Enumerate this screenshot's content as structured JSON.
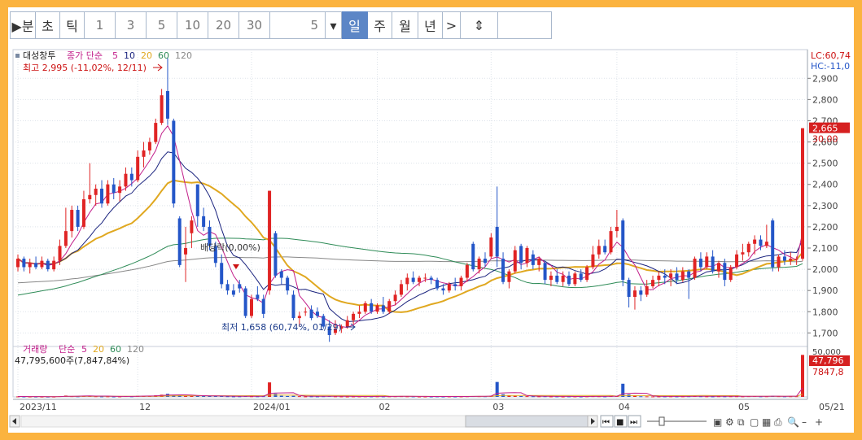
{
  "toolbar": {
    "items": [
      {
        "label": "▶분",
        "kind": "text"
      },
      {
        "label": "초",
        "kind": "text"
      },
      {
        "label": "틱",
        "kind": "text"
      },
      {
        "label": "1",
        "kind": "num"
      },
      {
        "label": "3",
        "kind": "num"
      },
      {
        "label": "5",
        "kind": "num"
      },
      {
        "label": "10",
        "kind": "num"
      },
      {
        "label": "20",
        "kind": "num"
      },
      {
        "label": "30",
        "kind": "num"
      },
      {
        "label": "5",
        "kind": "num"
      },
      {
        "label": "▾",
        "kind": "text"
      },
      {
        "label": "일",
        "kind": "active"
      },
      {
        "label": "주",
        "kind": "text"
      },
      {
        "label": "월",
        "kind": "text"
      },
      {
        "label": "년",
        "kind": "text"
      },
      {
        "label": ">",
        "kind": "text"
      },
      {
        "label": "⇕",
        "kind": "text"
      },
      {
        "label": "",
        "kind": "text"
      }
    ]
  },
  "legend": {
    "stock_name": "대성창투",
    "ma_label": "종가 단순",
    "ma_periods": [
      "5",
      "10",
      "20",
      "60",
      "120"
    ],
    "volume_name": "거래량",
    "volume_ma_label": "단순",
    "volume_ma_periods": [
      "5",
      "20",
      "60",
      "120"
    ],
    "volume_info": "47,795,600주(7,847,84%)"
  },
  "colors": {
    "up": "#e02424",
    "down": "#2456c8",
    "ma5": "#c21f8a",
    "ma10": "#1a237e",
    "ma20": "#e0a820",
    "ma60": "#2e8b57",
    "ma120": "#888888"
  },
  "annotations": {
    "high": "최고 2,995 (-11,02%, 12/11)",
    "low": "최저 1,658 (60,74%, 01/29)",
    "ex_dividend": "배당락(0,00%)"
  },
  "right_labels": {
    "lc": "LC:60,74",
    "hc": "HC:-11,0",
    "last_price": "2,665",
    "pct": "30,00",
    "last_volume": "47,796",
    "vol_sub": "7847,8",
    "vol_top": "50,000"
  },
  "chart_data": [
    {
      "type": "candlestick",
      "title": "",
      "y_ticks": [
        1700,
        1800,
        1900,
        2000,
        2100,
        2200,
        2300,
        2400,
        2500,
        2600,
        2700,
        2800,
        2900
      ],
      "ylim": [
        1640,
        3020
      ],
      "x_labels": [
        {
          "label": "2023/11",
          "index": 0
        },
        {
          "label": "12",
          "index": 20
        },
        {
          "label": "2024/01",
          "index": 39
        },
        {
          "label": "02",
          "index": 60
        },
        {
          "label": "03",
          "index": 79
        },
        {
          "label": "04",
          "index": 100
        },
        {
          "label": "05",
          "index": 120
        }
      ],
      "grid": true,
      "candles": [
        {
          "o": 2010,
          "h": 2070,
          "l": 1990,
          "c": 2050
        },
        {
          "o": 2050,
          "h": 2060,
          "l": 1990,
          "c": 2010
        },
        {
          "o": 2010,
          "h": 2050,
          "l": 1980,
          "c": 2030
        },
        {
          "o": 2030,
          "h": 2060,
          "l": 2000,
          "c": 2010
        },
        {
          "o": 2010,
          "h": 2060,
          "l": 2000,
          "c": 2040
        },
        {
          "o": 2040,
          "h": 2050,
          "l": 1990,
          "c": 2000
        },
        {
          "o": 2000,
          "h": 2060,
          "l": 1990,
          "c": 2040
        },
        {
          "o": 2040,
          "h": 2140,
          "l": 2020,
          "c": 2110
        },
        {
          "o": 2110,
          "h": 2290,
          "l": 2100,
          "c": 2180
        },
        {
          "o": 2180,
          "h": 2300,
          "l": 2150,
          "c": 2280
        },
        {
          "o": 2280,
          "h": 2300,
          "l": 2180,
          "c": 2200
        },
        {
          "o": 2200,
          "h": 2370,
          "l": 2190,
          "c": 2330
        },
        {
          "o": 2330,
          "h": 2500,
          "l": 2310,
          "c": 2350
        },
        {
          "o": 2350,
          "h": 2400,
          "l": 2300,
          "c": 2380
        },
        {
          "o": 2380,
          "h": 2420,
          "l": 2290,
          "c": 2310
        },
        {
          "o": 2310,
          "h": 2420,
          "l": 2300,
          "c": 2400
        },
        {
          "o": 2400,
          "h": 2430,
          "l": 2330,
          "c": 2360
        },
        {
          "o": 2360,
          "h": 2420,
          "l": 2320,
          "c": 2390
        },
        {
          "o": 2390,
          "h": 2480,
          "l": 2370,
          "c": 2450
        },
        {
          "o": 2450,
          "h": 2480,
          "l": 2390,
          "c": 2420
        },
        {
          "o": 2420,
          "h": 2560,
          "l": 2410,
          "c": 2530
        },
        {
          "o": 2530,
          "h": 2600,
          "l": 2480,
          "c": 2560
        },
        {
          "o": 2560,
          "h": 2620,
          "l": 2540,
          "c": 2600
        },
        {
          "o": 2600,
          "h": 2710,
          "l": 2590,
          "c": 2690
        },
        {
          "o": 2690,
          "h": 2850,
          "l": 2680,
          "c": 2820
        },
        {
          "o": 2840,
          "h": 2995,
          "l": 2680,
          "c": 2710
        },
        {
          "o": 2700,
          "h": 2710,
          "l": 2290,
          "c": 2310
        },
        {
          "o": 2240,
          "h": 2250,
          "l": 2010,
          "c": 2020
        },
        {
          "o": 2070,
          "h": 2200,
          "l": 1940,
          "c": 2100
        },
        {
          "o": 2170,
          "h": 2250,
          "l": 2100,
          "c": 2230
        },
        {
          "o": 2400,
          "h": 2400,
          "l": 2200,
          "c": 2250
        },
        {
          "o": 2250,
          "h": 2290,
          "l": 2180,
          "c": 2200
        },
        {
          "o": 2200,
          "h": 2230,
          "l": 2090,
          "c": 2110
        },
        {
          "o": 2110,
          "h": 2130,
          "l": 2010,
          "c": 2030
        },
        {
          "o": 2030,
          "h": 2070,
          "l": 1910,
          "c": 1930
        },
        {
          "o": 1930,
          "h": 1950,
          "l": 1880,
          "c": 1900
        },
        {
          "o": 1900,
          "h": 1930,
          "l": 1870,
          "c": 1880
        },
        {
          "o": 1930,
          "h": 1950,
          "l": 1890,
          "c": 1910
        },
        {
          "o": 1910,
          "h": 1920,
          "l": 1770,
          "c": 1780
        },
        {
          "o": 1780,
          "h": 1880,
          "l": 1770,
          "c": 1860
        },
        {
          "o": 1880,
          "h": 1920,
          "l": 1850,
          "c": 1860
        },
        {
          "o": 1860,
          "h": 1880,
          "l": 1770,
          "c": 1790
        },
        {
          "o": 1900,
          "h": 2370,
          "l": 1880,
          "c": 2370
        },
        {
          "o": 2170,
          "h": 2180,
          "l": 1960,
          "c": 1970
        },
        {
          "o": 1990,
          "h": 2000,
          "l": 1930,
          "c": 1960
        },
        {
          "o": 1960,
          "h": 1970,
          "l": 1880,
          "c": 1900
        },
        {
          "o": 1880,
          "h": 1900,
          "l": 1760,
          "c": 1770
        },
        {
          "o": 1770,
          "h": 1800,
          "l": 1730,
          "c": 1780
        },
        {
          "o": 1800,
          "h": 1820,
          "l": 1780,
          "c": 1800
        },
        {
          "o": 1810,
          "h": 1830,
          "l": 1760,
          "c": 1770
        },
        {
          "o": 1800,
          "h": 1820,
          "l": 1770,
          "c": 1780
        },
        {
          "o": 1780,
          "h": 1790,
          "l": 1720,
          "c": 1730
        },
        {
          "o": 1730,
          "h": 1760,
          "l": 1658,
          "c": 1690
        },
        {
          "o": 1700,
          "h": 1760,
          "l": 1690,
          "c": 1720
        },
        {
          "o": 1720,
          "h": 1740,
          "l": 1700,
          "c": 1730
        },
        {
          "o": 1730,
          "h": 1780,
          "l": 1720,
          "c": 1760
        },
        {
          "o": 1760,
          "h": 1800,
          "l": 1740,
          "c": 1790
        },
        {
          "o": 1790,
          "h": 1830,
          "l": 1770,
          "c": 1800
        },
        {
          "o": 1800,
          "h": 1850,
          "l": 1790,
          "c": 1840
        },
        {
          "o": 1840,
          "h": 1860,
          "l": 1790,
          "c": 1800
        },
        {
          "o": 1800,
          "h": 1840,
          "l": 1790,
          "c": 1830
        },
        {
          "o": 1830,
          "h": 1870,
          "l": 1790,
          "c": 1800
        },
        {
          "o": 1800,
          "h": 1860,
          "l": 1790,
          "c": 1850
        },
        {
          "o": 1850,
          "h": 1900,
          "l": 1830,
          "c": 1880
        },
        {
          "o": 1880,
          "h": 1950,
          "l": 1870,
          "c": 1930
        },
        {
          "o": 1930,
          "h": 1980,
          "l": 1900,
          "c": 1960
        },
        {
          "o": 1960,
          "h": 1990,
          "l": 1930,
          "c": 1940
        },
        {
          "o": 1940,
          "h": 1970,
          "l": 1920,
          "c": 1960
        },
        {
          "o": 1960,
          "h": 1980,
          "l": 1940,
          "c": 1960
        },
        {
          "o": 1960,
          "h": 1970,
          "l": 1930,
          "c": 1950
        },
        {
          "o": 1950,
          "h": 1960,
          "l": 1900,
          "c": 1910
        },
        {
          "o": 1910,
          "h": 1930,
          "l": 1880,
          "c": 1900
        },
        {
          "o": 1900,
          "h": 1940,
          "l": 1890,
          "c": 1930
        },
        {
          "o": 1930,
          "h": 1960,
          "l": 1900,
          "c": 1920
        },
        {
          "o": 1920,
          "h": 1970,
          "l": 1900,
          "c": 1960
        },
        {
          "o": 1960,
          "h": 2030,
          "l": 1940,
          "c": 2020
        },
        {
          "o": 2120,
          "h": 2130,
          "l": 1990,
          "c": 2000
        },
        {
          "o": 2000,
          "h": 2060,
          "l": 1980,
          "c": 2050
        },
        {
          "o": 2050,
          "h": 2080,
          "l": 2010,
          "c": 2030
        },
        {
          "o": 2060,
          "h": 2170,
          "l": 2050,
          "c": 2150
        },
        {
          "o": 2200,
          "h": 2390,
          "l": 2010,
          "c": 2060
        },
        {
          "o": 2050,
          "h": 2080,
          "l": 1930,
          "c": 1940
        },
        {
          "o": 1940,
          "h": 2000,
          "l": 1910,
          "c": 1990
        },
        {
          "o": 1990,
          "h": 2110,
          "l": 1980,
          "c": 2090
        },
        {
          "o": 2110,
          "h": 2120,
          "l": 2000,
          "c": 2030
        },
        {
          "o": 2030,
          "h": 2110,
          "l": 2010,
          "c": 2100
        },
        {
          "o": 2070,
          "h": 2090,
          "l": 2000,
          "c": 2020
        },
        {
          "o": 2020,
          "h": 2060,
          "l": 1990,
          "c": 2050
        },
        {
          "o": 2030,
          "h": 2040,
          "l": 1930,
          "c": 1950
        },
        {
          "o": 1950,
          "h": 1990,
          "l": 1920,
          "c": 1970
        },
        {
          "o": 1970,
          "h": 2000,
          "l": 1930,
          "c": 1940
        },
        {
          "o": 1940,
          "h": 1990,
          "l": 1920,
          "c": 1970
        },
        {
          "o": 1970,
          "h": 1990,
          "l": 1920,
          "c": 1930
        },
        {
          "o": 1930,
          "h": 1990,
          "l": 1920,
          "c": 1980
        },
        {
          "o": 1980,
          "h": 2000,
          "l": 1940,
          "c": 1950
        },
        {
          "o": 1950,
          "h": 2020,
          "l": 1940,
          "c": 2010
        },
        {
          "o": 2010,
          "h": 2110,
          "l": 2000,
          "c": 2070
        },
        {
          "o": 2070,
          "h": 2140,
          "l": 2050,
          "c": 2110
        },
        {
          "o": 2110,
          "h": 2140,
          "l": 2070,
          "c": 2080
        },
        {
          "o": 2080,
          "h": 2200,
          "l": 2070,
          "c": 2180
        },
        {
          "o": 2180,
          "h": 2280,
          "l": 2150,
          "c": 2200
        },
        {
          "o": 2230,
          "h": 2240,
          "l": 1920,
          "c": 1950
        },
        {
          "o": 1950,
          "h": 1960,
          "l": 1820,
          "c": 1870
        },
        {
          "o": 1870,
          "h": 1920,
          "l": 1810,
          "c": 1900
        },
        {
          "o": 1900,
          "h": 1920,
          "l": 1850,
          "c": 1880
        },
        {
          "o": 1880,
          "h": 1950,
          "l": 1870,
          "c": 1920
        },
        {
          "o": 1920,
          "h": 1970,
          "l": 1910,
          "c": 1950
        },
        {
          "o": 1950,
          "h": 1990,
          "l": 1920,
          "c": 1970
        },
        {
          "o": 1970,
          "h": 2000,
          "l": 1930,
          "c": 1960
        },
        {
          "o": 1960,
          "h": 2000,
          "l": 1920,
          "c": 1980
        },
        {
          "o": 1980,
          "h": 2010,
          "l": 1930,
          "c": 1950
        },
        {
          "o": 1950,
          "h": 2010,
          "l": 1940,
          "c": 1990
        },
        {
          "o": 1990,
          "h": 2000,
          "l": 1860,
          "c": 1960
        },
        {
          "o": 1960,
          "h": 2060,
          "l": 1950,
          "c": 2050
        },
        {
          "o": 2050,
          "h": 2080,
          "l": 1990,
          "c": 2010
        },
        {
          "o": 2010,
          "h": 2080,
          "l": 2000,
          "c": 2060
        },
        {
          "o": 2060,
          "h": 2090,
          "l": 1980,
          "c": 1990
        },
        {
          "o": 1990,
          "h": 2040,
          "l": 1960,
          "c": 2030
        },
        {
          "o": 2030,
          "h": 2050,
          "l": 1920,
          "c": 1950
        },
        {
          "o": 1950,
          "h": 2020,
          "l": 1940,
          "c": 2010
        },
        {
          "o": 2010,
          "h": 2090,
          "l": 2000,
          "c": 2070
        },
        {
          "o": 2070,
          "h": 2120,
          "l": 2040,
          "c": 2080
        },
        {
          "o": 2080,
          "h": 2130,
          "l": 2060,
          "c": 2120
        },
        {
          "o": 2120,
          "h": 2160,
          "l": 2070,
          "c": 2140
        },
        {
          "o": 2140,
          "h": 2160,
          "l": 2090,
          "c": 2110
        },
        {
          "o": 2110,
          "h": 2210,
          "l": 2100,
          "c": 2130
        },
        {
          "o": 2230,
          "h": 2240,
          "l": 1990,
          "c": 2010
        },
        {
          "o": 2010,
          "h": 2070,
          "l": 1990,
          "c": 2060
        },
        {
          "o": 2060,
          "h": 2090,
          "l": 2020,
          "c": 2040
        },
        {
          "o": 2040,
          "h": 2080,
          "l": 2020,
          "c": 2050
        },
        {
          "o": 2050,
          "h": 2060,
          "l": 2020,
          "c": 2050
        },
        {
          "o": 2050,
          "h": 2665,
          "l": 2040,
          "c": 2665
        }
      ]
    },
    {
      "type": "bar",
      "title": "",
      "unit": "주",
      "ylim": [
        0,
        50000000
      ],
      "spike_indices": [
        42,
        79,
        101,
        131
      ],
      "values": [
        500000,
        400000,
        350000,
        300000,
        300000,
        250000,
        300000,
        900000,
        1500000,
        800000,
        600000,
        1200000,
        1400000,
        700000,
        500000,
        600000,
        400000,
        500000,
        900000,
        600000,
        1200000,
        1300000,
        1100000,
        1800000,
        2500000,
        3500000,
        2200000,
        1800000,
        1500000,
        1300000,
        1400000,
        900000,
        1000000,
        900000,
        1100000,
        700000,
        500000,
        600000,
        900000,
        700000,
        600000,
        800000,
        16500000,
        3500000,
        1300000,
        1000000,
        1200000,
        800000,
        500000,
        600000,
        500000,
        700000,
        900000,
        600000,
        500000,
        400000,
        500000,
        500000,
        600000,
        500000,
        600000,
        500000,
        600000,
        700000,
        800000,
        600000,
        500000,
        400000,
        400000,
        400000,
        500000,
        400000,
        500000,
        400000,
        500000,
        700000,
        900000,
        800000,
        700000,
        1300000,
        17000000,
        3000000,
        1500000,
        1200000,
        900000,
        800000,
        700000,
        600000,
        700000,
        500000,
        500000,
        400000,
        500000,
        500000,
        400000,
        600000,
        800000,
        700000,
        500000,
        900000,
        1100000,
        15000000,
        2800000,
        1400000,
        700000,
        600000,
        500000,
        500000,
        500000,
        600000,
        500000,
        600000,
        700000,
        900000,
        700000,
        600000,
        500000,
        700000,
        600000,
        700000,
        700000,
        600000,
        800000,
        900000,
        600000,
        700000,
        1200000,
        800000,
        600000,
        700000,
        700000,
        47795600
      ]
    }
  ]
}
